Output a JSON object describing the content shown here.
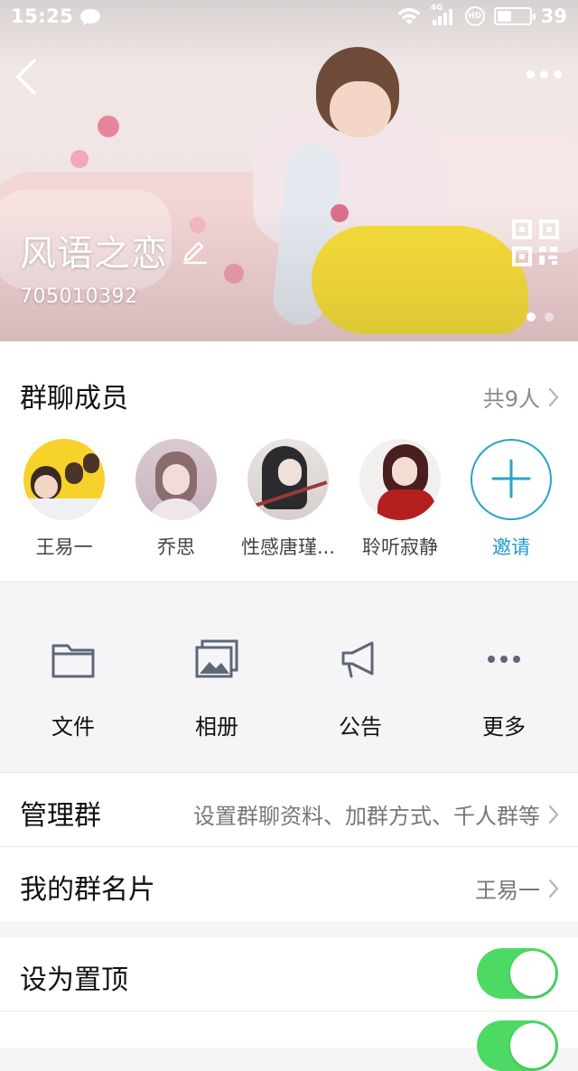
{
  "status_bar": {
    "time": "15:25",
    "network": "4G",
    "hd_badge": "HD",
    "battery_percent": "39",
    "battery_level": 0.39
  },
  "header": {
    "group_name": "风语之恋",
    "group_id": "705010392",
    "carousel_pages": 2,
    "carousel_active": 1
  },
  "members": {
    "title": "群聊成员",
    "count_label": "共9人",
    "list": [
      {
        "name": "王易一"
      },
      {
        "name": "乔思"
      },
      {
        "name": "性感唐瑾..."
      },
      {
        "name": "聆听寂静"
      }
    ],
    "invite_label": "邀请"
  },
  "actions": [
    {
      "label": "文件",
      "icon": "folder-icon"
    },
    {
      "label": "相册",
      "icon": "photo-album-icon"
    },
    {
      "label": "公告",
      "icon": "announcement-icon"
    },
    {
      "label": "更多",
      "icon": "more-dots-icon"
    }
  ],
  "settings": {
    "manage_group": {
      "label": "管理群",
      "value": "设置群聊资料、加群方式、千人群等"
    },
    "my_card": {
      "label": "我的群名片",
      "value": "王易一"
    },
    "pin_top": {
      "label": "设为置顶",
      "on": true
    }
  },
  "colors": {
    "accent_blue": "#1d9bd1",
    "toggle_on": "#4cd964"
  }
}
